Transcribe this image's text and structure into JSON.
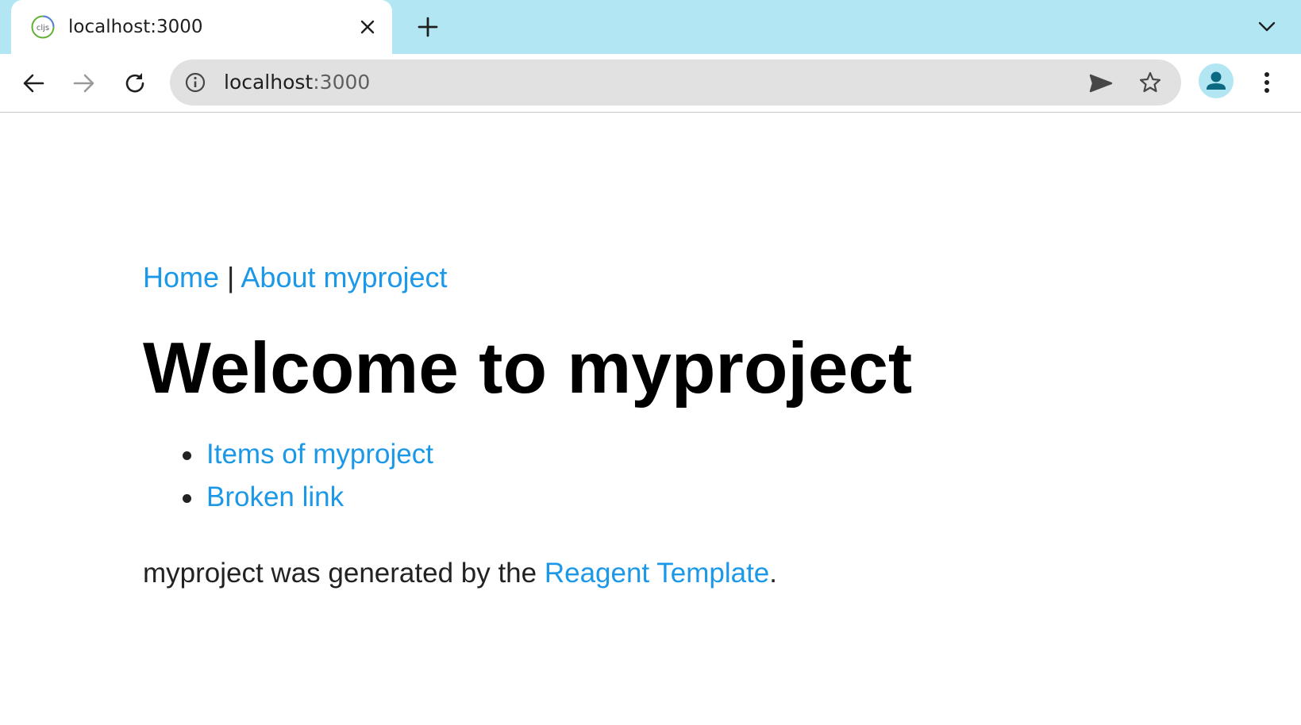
{
  "browser": {
    "tab": {
      "title": "localhost:3000",
      "favicon_text": "cljs",
      "close_icon": "close-icon"
    },
    "new_tab_icon": "plus-icon",
    "tab_list_icon": "chevron-down-icon",
    "address": {
      "host": "localhost",
      "port": ":3000"
    },
    "icons": [
      "back-arrow-icon",
      "forward-arrow-icon",
      "reload-icon",
      "info-icon",
      "send-icon",
      "star-icon",
      "profile-icon",
      "menu-icon"
    ],
    "colors": {
      "tabstrip": "#b3e6f3",
      "omnibox": "#e1e1e1",
      "link": "#1b98e8"
    }
  },
  "page": {
    "nav": {
      "home": "Home",
      "separator": "|",
      "about": "About myproject"
    },
    "heading": "Welcome to myproject",
    "links": [
      {
        "label": "Items of myproject"
      },
      {
        "label": "Broken link"
      }
    ],
    "footer": {
      "before": "myproject was generated by the ",
      "link": "Reagent Template",
      "after": "."
    }
  }
}
